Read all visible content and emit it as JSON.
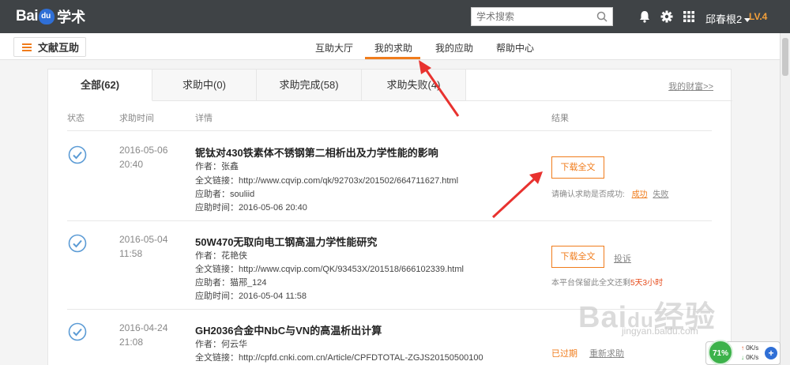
{
  "topbar": {
    "logo_bai": "Bai",
    "logo_du": "du",
    "logo_xueshu": "学术",
    "search_placeholder": "学术搜索",
    "username": "邱春根2",
    "level": "LV.4",
    "icons": [
      "bell-icon",
      "gear-icon",
      "grid-icon"
    ]
  },
  "subnav": {
    "menu_label": "文献互助",
    "items": [
      "互助大厅",
      "我的求助",
      "我的应助",
      "帮助中心"
    ],
    "active": "我的求助"
  },
  "tabs": [
    {
      "label": "全部(62)",
      "active": true
    },
    {
      "label": "求助中(0)",
      "active": false
    },
    {
      "label": "求助完成(58)",
      "active": false
    },
    {
      "label": "求助失败(4)",
      "active": false
    }
  ],
  "wealth_link": "我的财富>>",
  "columns": {
    "status": "状态",
    "time": "求助时间",
    "detail": "详情",
    "result": "结果"
  },
  "labels": {
    "author": "作者：",
    "link": "全文链接：",
    "responder": "应助者：",
    "respond_time": "应助时间："
  },
  "rows": [
    {
      "date": "2016-05-06",
      "time": "20:40",
      "title": "铌钛对430铁素体不锈钢第二相析出及力学性能的影响",
      "author": "张鑫",
      "link": "http://www.cqvip.com/qk/92703x/201502/664711627.html",
      "responder": "souliid",
      "respond_time": "2016-05-06 20:40",
      "button": "下载全文",
      "note": "请确认求助是否成功:",
      "action1": "成功",
      "action2": "失败"
    },
    {
      "date": "2016-05-04",
      "time": "11:58",
      "title": "50W470无取向电工钢高温力学性能研究",
      "author": "花艳侠",
      "link": "http://www.cqvip.com/QK/93453X/201518/666102339.html",
      "responder": "猫郉_124",
      "respond_time": "2016-05-04 11:58",
      "button": "下载全文",
      "complain": "投诉",
      "note_pre": "本平台保留此全文还剩",
      "note_days": "5天3小时"
    },
    {
      "date": "2016-04-24",
      "time": "21:08",
      "title": "GH2036合金中NbC与VN的高温析出计算",
      "author": "何云华",
      "link": "http://cpfd.cnki.com.cn/Article/CPFDTOTAL-ZGJS20150500100",
      "expired": "已过期",
      "rehelp": "重新求助"
    }
  ],
  "watermark": {
    "main": "Bai",
    "du": "du",
    "cn": "经验",
    "url": "jingyan.baidu.com"
  },
  "netmon": {
    "percent": "71%",
    "up": "0K/s",
    "down": "0K/s"
  }
}
